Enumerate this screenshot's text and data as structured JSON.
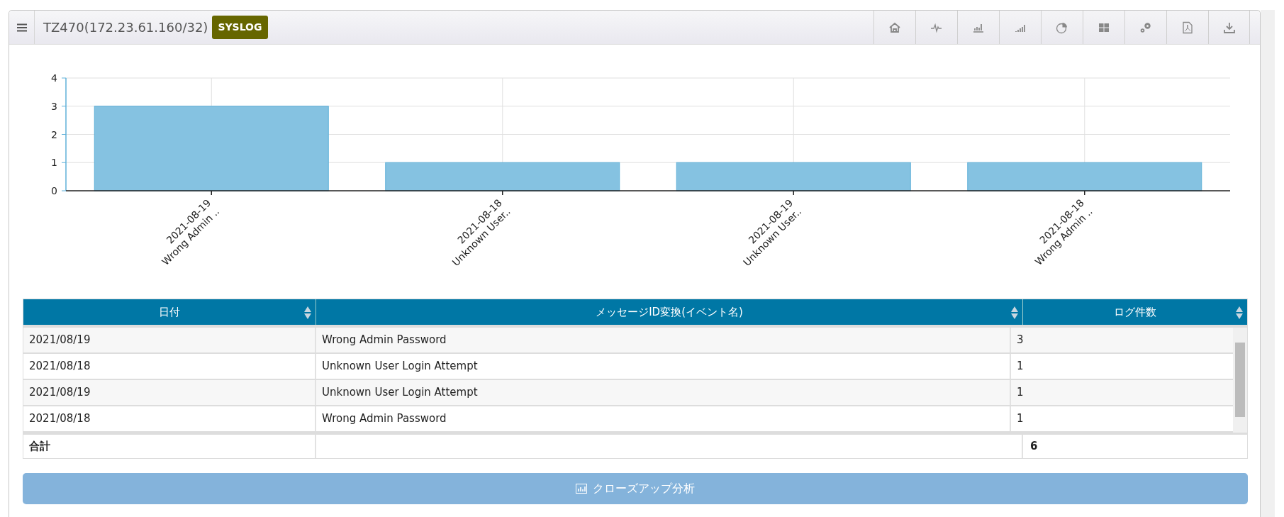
{
  "header": {
    "title": "TZ470(172.23.61.160/32)",
    "badge": "SYSLOG"
  },
  "toolbar": [
    {
      "kind": "home"
    },
    {
      "kind": "pulse"
    },
    {
      "kind": "bars"
    },
    {
      "kind": "signal"
    },
    {
      "kind": "pie"
    },
    {
      "kind": "grid"
    },
    {
      "kind": "gears"
    },
    {
      "kind": "pdf"
    },
    {
      "kind": "download"
    }
  ],
  "chart": {
    "chart_data": {
      "type": "bar",
      "categories": [
        "2021-08-19\nWrong Admin ..",
        "2021-08-18\nUnknown User..",
        "2021-08-19\nUnknown User..",
        "2021-08-18\nWrong Admin .."
      ],
      "series": [
        {
          "color": "#85c2e1",
          "values": [
            3,
            1,
            1,
            1
          ]
        }
      ],
      "grid": true,
      "ylim": [
        0,
        4
      ],
      "yticks": [
        0,
        1,
        2,
        3,
        4
      ]
    }
  },
  "table": {
    "columns": [
      {
        "label": "日付"
      },
      {
        "label": "メッセージID変換(イベント名)"
      },
      {
        "label": "ログ件数"
      }
    ],
    "rows": [
      [
        "2021/08/19",
        "Wrong Admin Password",
        "3"
      ],
      [
        "2021/08/18",
        "Unknown User Login Attempt",
        "1"
      ],
      [
        "2021/08/19",
        "Unknown User Login Attempt",
        "1"
      ],
      [
        "2021/08/18",
        "Wrong Admin Password",
        "1"
      ]
    ],
    "total": {
      "label": "合計",
      "value": "6"
    }
  },
  "closeup_button": {
    "label": "クローズアップ分析"
  }
}
